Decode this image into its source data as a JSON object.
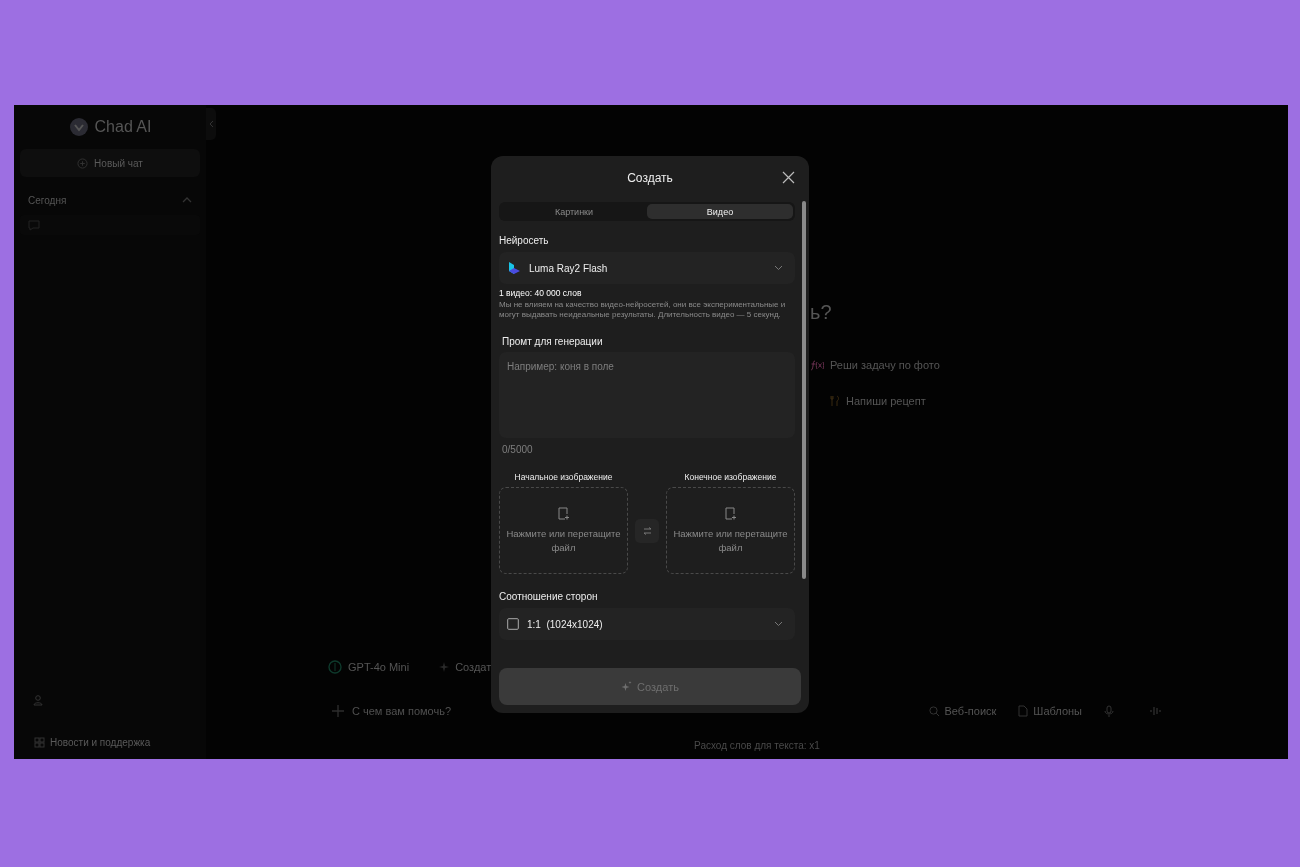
{
  "sidebar": {
    "logo_text": "Chad AI",
    "new_chat_button": "Новый чат",
    "section": {
      "title": "Сегодня",
      "expanded": true
    },
    "footer_link": "Новости и поддержка"
  },
  "main": {
    "heading_fragment": "ь?",
    "suggestions": [
      {
        "label": "Реши задачу по фото",
        "kind": "math"
      },
      {
        "label": "Напиши рецепт",
        "kind": "recipe"
      }
    ],
    "model_chip": "GPT-4o Mini",
    "create_chip_fragment": "Создат",
    "input": {
      "placeholder": "С чем вам помочь?"
    },
    "tools": [
      {
        "label": "Веб-поиск",
        "kind": "search"
      },
      {
        "label": "Шаблоны",
        "kind": "templates"
      },
      {
        "kind": "mic"
      },
      {
        "kind": "voice"
      }
    ],
    "footer_note": "Расход слов для текста: x1"
  },
  "modal": {
    "title": "Создать",
    "tabs": [
      {
        "label": "Картинки",
        "selected": false
      },
      {
        "label": "Видео",
        "selected": true
      }
    ],
    "model_label": "Нейросеть",
    "model_select": "Luma Ray2 Flash",
    "cost": "1 видео: 40 000 слов",
    "disclaimer": "Мы не влияем на качество видео-нейросетей, они все экспериментальные и могут выдавать неидеальные результаты. Длительность видео — 5 секунд.",
    "prompt_label": "Промт для генерации",
    "prompt": {
      "placeholder": "Например: коня в поле"
    },
    "counter": "0/5000",
    "uploads": [
      {
        "label": "Начальное изображение",
        "hint": "Нажмите или перетащите файл"
      },
      {
        "label": "Конечное изображение",
        "hint": "Нажмите или перетащите файл"
      }
    ],
    "aspect_label": "Соотношение сторон",
    "aspect_select": "1:1  (1024x1024)",
    "submit": {
      "label": "Создать",
      "disabled": true
    }
  }
}
